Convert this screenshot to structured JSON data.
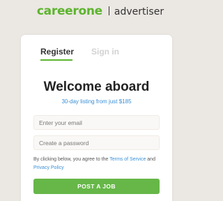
{
  "header": {
    "brand": "careerone",
    "product": "advertiser"
  },
  "tabs": {
    "register": "Register",
    "signin": "Sign in"
  },
  "form": {
    "title": "Welcome aboard",
    "subtitle": "30-day listing from just $185",
    "email_placeholder": "Enter your email",
    "email_value": "",
    "password_placeholder": "Create a password",
    "password_value": "",
    "terms_prefix": "By clicking below, you agree to the ",
    "terms_link": "Terms of Service",
    "terms_and": " and ",
    "privacy_link": "Privacy Policy",
    "submit_label": "POST A JOB"
  },
  "colors": {
    "brand_green": "#5cb42e",
    "button_green": "#66b748",
    "link_blue": "#3a8fd6",
    "background": "#ebe7e3"
  }
}
